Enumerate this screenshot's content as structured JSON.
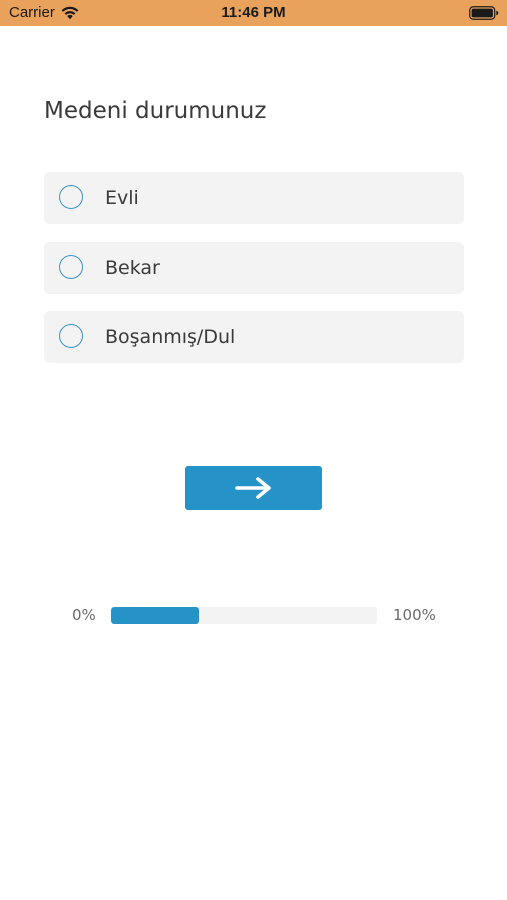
{
  "status_bar": {
    "carrier": "Carrier",
    "time": "11:46 PM",
    "icons": [
      "wifi-icon",
      "battery-icon"
    ]
  },
  "question": {
    "title": "Medeni durumunuz"
  },
  "options": [
    {
      "label": "Evli",
      "selected": false
    },
    {
      "label": "Bekar",
      "selected": false
    },
    {
      "label": "Boşanmış/Dul",
      "selected": false
    }
  ],
  "next_button": {
    "icon": "arrow-right-icon"
  },
  "progress": {
    "min_label": "0%",
    "max_label": "100%",
    "value": 0.33
  },
  "colors": {
    "status_bar": "#e8a25c",
    "accent": "#2593c8",
    "option_background": "#f3f3f3",
    "radio_border": "#3a93c7"
  }
}
